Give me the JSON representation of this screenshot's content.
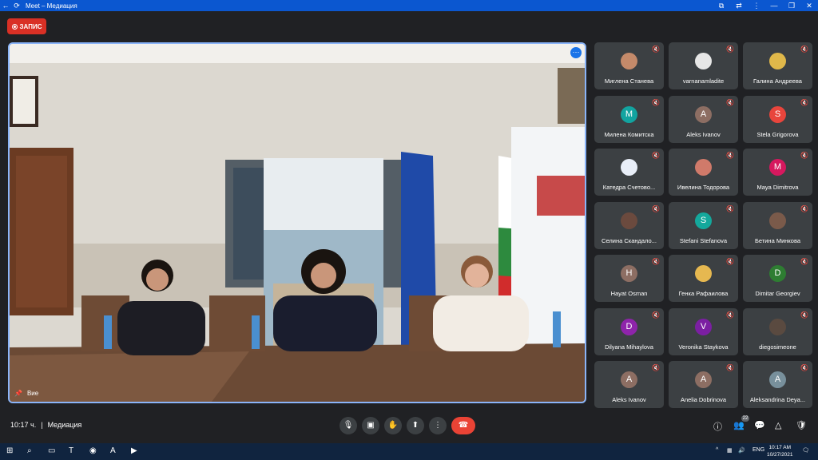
{
  "window": {
    "title": "Meet – Медиация"
  },
  "record": {
    "label": "ЗАПИС"
  },
  "main_video": {
    "self_label": "Вие"
  },
  "participants": [
    {
      "name": "Миглена Станева",
      "initial": "",
      "color": "#c48a6a"
    },
    {
      "name": "varnanamladite",
      "initial": "",
      "color": "#e6e6e6"
    },
    {
      "name": "Галина Андреева",
      "initial": "",
      "color": "#e0b84a"
    },
    {
      "name": "Милена Комитска",
      "initial": "M",
      "color": "#12a4a0"
    },
    {
      "name": "Aleks Ivanov",
      "initial": "A",
      "color": "#8d6e63"
    },
    {
      "name": "Stela Grigorova",
      "initial": "S",
      "color": "#e8453c"
    },
    {
      "name": "Катедра Счетово...",
      "initial": "",
      "color": "#e8eef8"
    },
    {
      "name": "Ивелина Тодорова",
      "initial": "",
      "color": "#d07a6a"
    },
    {
      "name": "Maya Dimitrova",
      "initial": "M",
      "color": "#d6185e"
    },
    {
      "name": "Селина Скандало...",
      "initial": "",
      "color": "#6b4a3e"
    },
    {
      "name": "Stefani Stefanova",
      "initial": "S",
      "color": "#14a89c"
    },
    {
      "name": "Бетина Минкова",
      "initial": "",
      "color": "#7a5a4a"
    },
    {
      "name": "Hayat Osman",
      "initial": "H",
      "color": "#8d6e63"
    },
    {
      "name": "Генка Рафаилова",
      "initial": "",
      "color": "#e6b850"
    },
    {
      "name": "Dimitar Georgiev",
      "initial": "D",
      "color": "#2e7d32"
    },
    {
      "name": "Dilyana Mihaylova",
      "initial": "D",
      "color": "#8e24aa"
    },
    {
      "name": "Veronika Staykova",
      "initial": "V",
      "color": "#7b1fa2"
    },
    {
      "name": "diegosimeone",
      "initial": "",
      "color": "#5a4a40"
    },
    {
      "name": "Aleks Ivanov",
      "initial": "A",
      "color": "#8d6e63"
    },
    {
      "name": "Anelia Dobrinova",
      "initial": "A",
      "color": "#8d6e63"
    },
    {
      "name": "Aleksandrina Deya...",
      "initial": "A",
      "color": "#78909c"
    }
  ],
  "meeting": {
    "time": "10:17 ч.",
    "separator": "|",
    "name": "Медиация",
    "participant_count": "22"
  },
  "taskbar": {
    "lang": "ENG",
    "time": "10:17 AM",
    "date": "10/27/2021"
  }
}
